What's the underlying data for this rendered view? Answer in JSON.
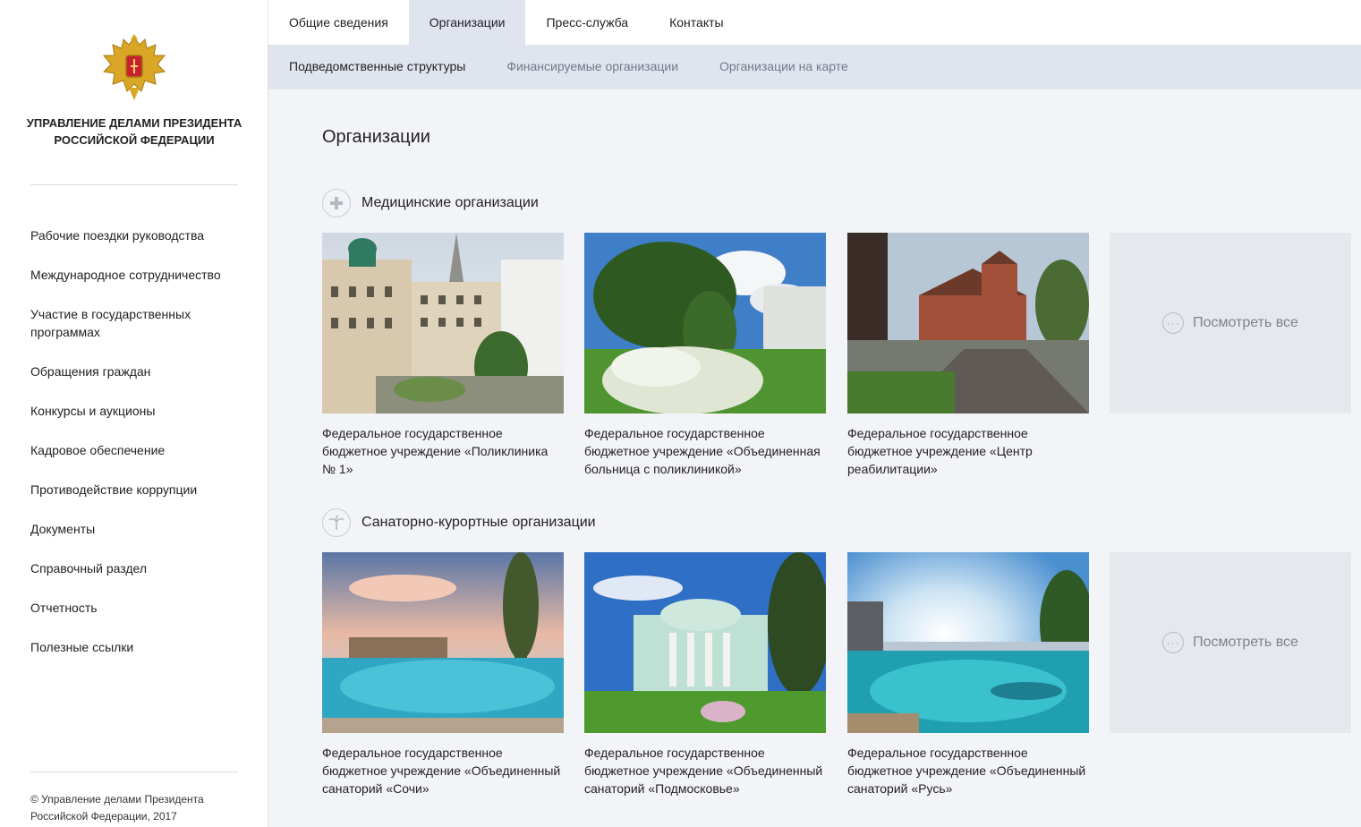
{
  "sidebar": {
    "org_name": "Управление делами Президента Российской Федерации",
    "menu": [
      "Рабочие поездки руководства",
      "Международное сотрудничество",
      "Участие в государственных программах",
      "Обращения граждан",
      "Конкурсы и аукционы",
      "Кадровое обеспечение",
      "Противодействие коррупции",
      "Документы",
      "Справочный раздел",
      "Отчетность",
      "Полезные ссылки"
    ],
    "copyright": "© Управление делами Президента Российской Федерации, 2017"
  },
  "topnav": {
    "tabs": [
      "Общие сведения",
      "Организации",
      "Пресс-служба",
      "Контакты"
    ],
    "active": "Организации"
  },
  "subnav": {
    "items": [
      "Подведомственные структуры",
      "Финансируемые организации",
      "Организации на карте"
    ],
    "active": "Подведомственные структуры"
  },
  "main": {
    "title": "Организации",
    "sections": [
      {
        "title": "Медицинские организации",
        "icon": "plus-icon",
        "cards": [
          {
            "caption": "Федеральное государственное бюджетное учреждение «Поликлиника № 1»",
            "image": "building-courtyard"
          },
          {
            "caption": "Федеральное государственное бюджетное учреждение «Объединенная больница с поликлиникой»",
            "image": "garden-hydrangea"
          },
          {
            "caption": "Федеральное государственное бюджетное учреждение «Центр реабилитации»",
            "image": "brick-manor"
          }
        ],
        "view_all": "Посмотреть все"
      },
      {
        "title": "Санаторно-курортные организации",
        "icon": "palm-icon",
        "cards": [
          {
            "caption": "Федеральное государственное бюджетное учреждение «Объединенный санаторий «Сочи»",
            "image": "pool-sunset"
          },
          {
            "caption": "Федеральное государственное бюджетное учреждение «Объединенный санаторий «Подмосковье»",
            "image": "mansion-green"
          },
          {
            "caption": "Федеральное государственное бюджетное учреждение «Объединенный санаторий «Русь»",
            "image": "pool-sea"
          }
        ],
        "view_all": "Посмотреть все"
      }
    ]
  }
}
